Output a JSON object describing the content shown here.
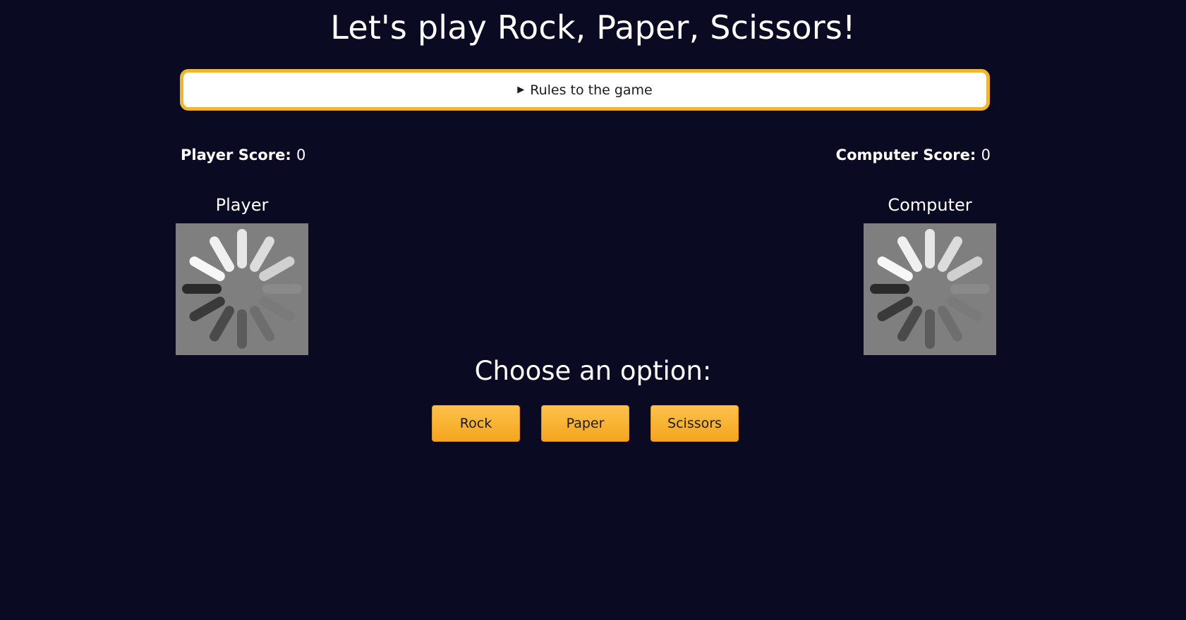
{
  "header": {
    "title": "Let's play Rock, Paper, Scissors!"
  },
  "rules": {
    "label": "Rules to the game",
    "expanded": false
  },
  "scores": {
    "player_label": "Player Score:",
    "player_value": "0",
    "computer_label": "Computer Score:",
    "computer_value": "0"
  },
  "arena": {
    "player_label": "Player",
    "computer_label": "Computer",
    "player_image": "loading-spinner-icon",
    "computer_image": "loading-spinner-icon"
  },
  "options": {
    "heading": "Choose an option:",
    "buttons": [
      "Rock",
      "Paper",
      "Scissors"
    ]
  },
  "colors": {
    "background": "#0a0b23",
    "accent": "#f2b62c",
    "button": "#fbb034"
  }
}
